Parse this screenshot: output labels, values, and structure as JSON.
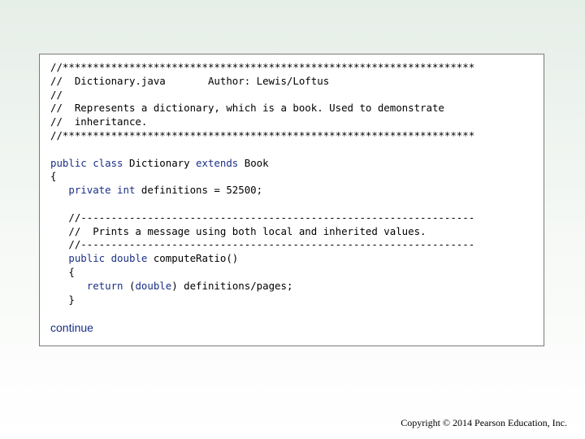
{
  "code": {
    "lines": [
      [
        {
          "t": "c",
          "s": "//********************************************************************"
        }
      ],
      [
        {
          "t": "c",
          "s": "//  Dictionary.java       Author: Lewis/Loftus"
        }
      ],
      [
        {
          "t": "c",
          "s": "//"
        }
      ],
      [
        {
          "t": "c",
          "s": "//  Represents a dictionary, which is a book. Used to demonstrate"
        }
      ],
      [
        {
          "t": "c",
          "s": "//  inheritance."
        }
      ],
      [
        {
          "t": "c",
          "s": "//********************************************************************"
        }
      ],
      [],
      [
        {
          "t": "k",
          "s": "public class "
        },
        {
          "t": "p",
          "s": "Dictionary "
        },
        {
          "t": "k",
          "s": "extends "
        },
        {
          "t": "p",
          "s": "Book"
        }
      ],
      [
        {
          "t": "p",
          "s": "{"
        }
      ],
      [
        {
          "t": "k",
          "s": "   private int "
        },
        {
          "t": "p",
          "s": "definitions = 52500;"
        }
      ],
      [],
      [
        {
          "t": "c",
          "s": "   //-----------------------------------------------------------------"
        }
      ],
      [
        {
          "t": "c",
          "s": "   //  Prints a message using both local and inherited values."
        }
      ],
      [
        {
          "t": "c",
          "s": "   //-----------------------------------------------------------------"
        }
      ],
      [
        {
          "t": "k",
          "s": "   public double "
        },
        {
          "t": "p",
          "s": "computeRatio()"
        }
      ],
      [
        {
          "t": "p",
          "s": "   {"
        }
      ],
      [
        {
          "t": "k",
          "s": "      return "
        },
        {
          "t": "p",
          "s": "("
        },
        {
          "t": "k",
          "s": "double"
        },
        {
          "t": "p",
          "s": ") definitions/pages;"
        }
      ],
      [
        {
          "t": "p",
          "s": "   }"
        }
      ]
    ]
  },
  "continue_label": "continue",
  "footer": "Copyright © 2014 Pearson Education, Inc."
}
